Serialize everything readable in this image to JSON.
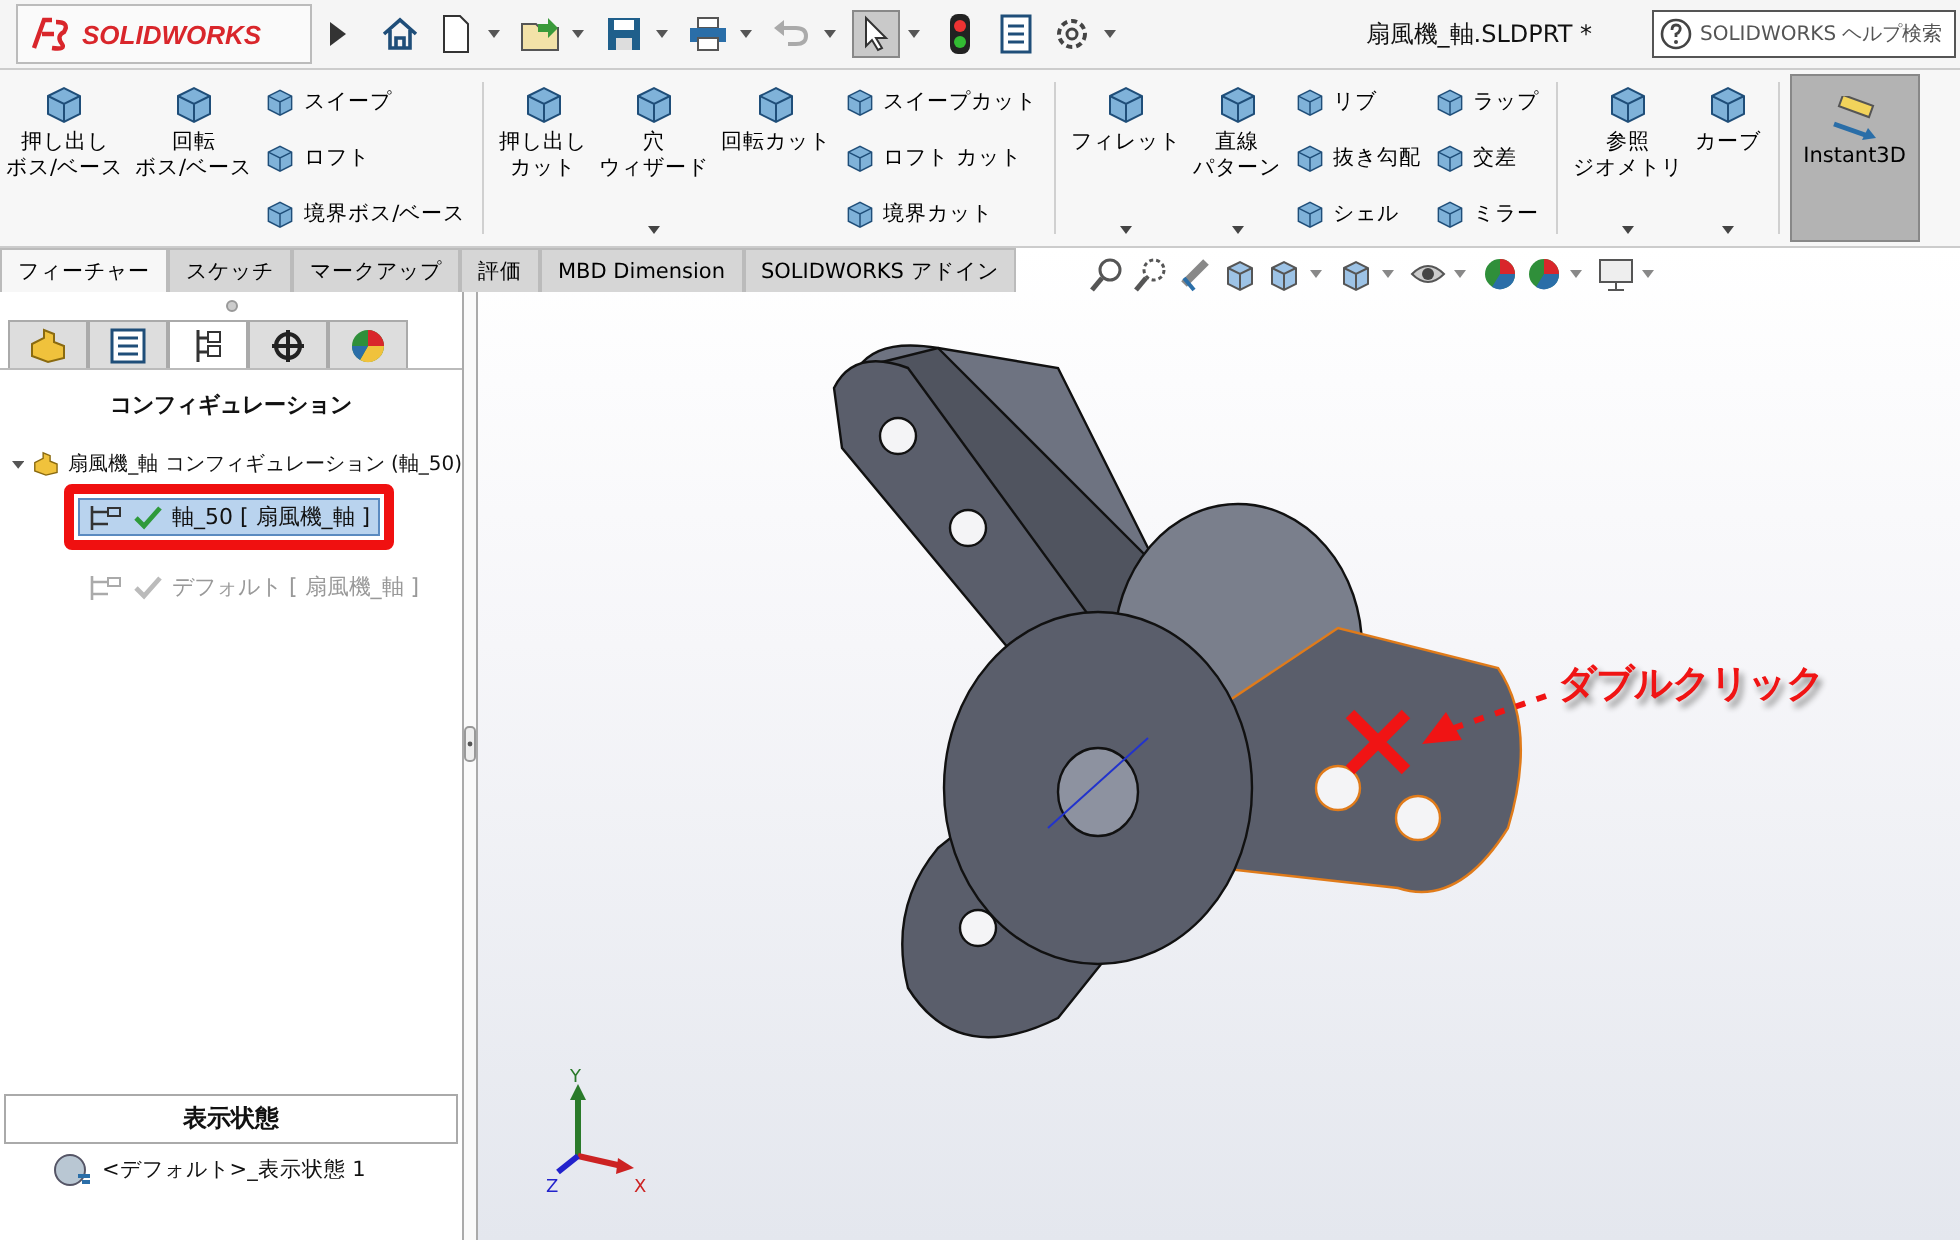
{
  "app": {
    "logo": "SOLIDWORKS"
  },
  "document_title": "扇風機_軸.SLDPRT *",
  "help_search": {
    "placeholder": "SOLIDWORKS ヘルプ検索"
  },
  "ribbon_groups": [
    {
      "columns": [
        {
          "kind": "large",
          "lines": [
            "押し出し",
            "ボス/ベース"
          ],
          "dropdown": false
        },
        {
          "kind": "large",
          "lines": [
            "回転",
            "ボス/ベース"
          ],
          "dropdown": false
        },
        {
          "kind": "stack",
          "items": [
            "スイープ",
            "ロフト",
            "境界ボス/ベース"
          ]
        }
      ]
    },
    {
      "columns": [
        {
          "kind": "large",
          "lines": [
            "押し出し",
            "カット"
          ],
          "dropdown": false
        },
        {
          "kind": "large",
          "lines": [
            "穴",
            "ウィザード"
          ],
          "dropdown": true
        },
        {
          "kind": "large",
          "lines": [
            "回転カット"
          ],
          "dropdown": false
        },
        {
          "kind": "stack",
          "items": [
            "スイープカット",
            "ロフト カット",
            "境界カット"
          ]
        }
      ]
    },
    {
      "columns": [
        {
          "kind": "large",
          "lines": [
            "フィレット"
          ],
          "dropdown": true
        },
        {
          "kind": "large",
          "lines": [
            "直線",
            "パターン"
          ],
          "dropdown": true
        },
        {
          "kind": "stack",
          "items": [
            "リブ",
            "抜き勾配",
            "シェル"
          ]
        },
        {
          "kind": "stack",
          "items": [
            "ラップ",
            "交差",
            "ミラー"
          ]
        }
      ]
    },
    {
      "columns": [
        {
          "kind": "large",
          "lines": [
            "参照",
            "ジオメトリ"
          ],
          "dropdown": true
        },
        {
          "kind": "large",
          "lines": [
            "カーブ"
          ],
          "dropdown": true
        }
      ]
    }
  ],
  "instant3d": {
    "label": "Instant3D",
    "selected": true
  },
  "tabs": [
    {
      "label": "フィーチャー",
      "selected": true
    },
    {
      "label": "スケッチ",
      "selected": false
    },
    {
      "label": "マークアップ",
      "selected": false
    },
    {
      "label": "評価",
      "selected": false
    },
    {
      "label": "MBD Dimension",
      "selected": false
    },
    {
      "label": "SOLIDWORKS アドイン",
      "selected": false
    }
  ],
  "panel_tabs": [
    {
      "kind": "feature",
      "selected": false
    },
    {
      "kind": "property",
      "selected": false
    },
    {
      "kind": "configuration",
      "selected": true
    },
    {
      "kind": "dimxpert",
      "selected": false
    },
    {
      "kind": "display",
      "selected": false
    }
  ],
  "panel_title": "コンフィギュレーション",
  "tree": {
    "label": "扇風機_軸 コンフィギュレーション (軸_50)",
    "expanded": true,
    "children": [
      {
        "label": "軸_50 [ 扇風機_軸 ]",
        "selected": true,
        "active": true
      },
      {
        "label": "デフォルト [ 扇風機_軸 ]",
        "selected": false,
        "active": false
      }
    ]
  },
  "display_states": {
    "title": "表示状態",
    "items": [
      "<デフォルト>_表示状態 1"
    ]
  },
  "annotation": {
    "text": "ダブルクリック"
  },
  "triad": {
    "y": "Y",
    "z": "Z",
    "x": "X"
  }
}
